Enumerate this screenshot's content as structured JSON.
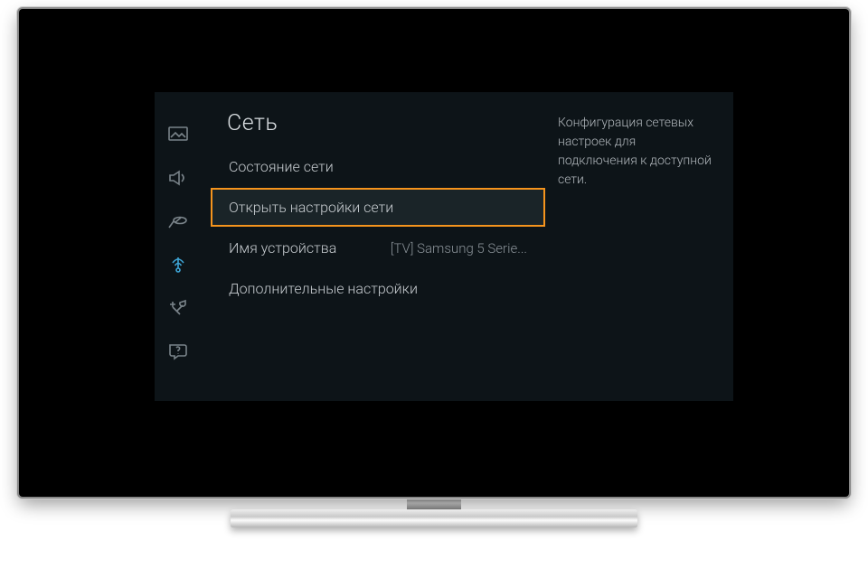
{
  "panel": {
    "title": "Сеть",
    "info_text": "Конфигурация сетевых настроек для подключения к доступной сети."
  },
  "menu": {
    "items": [
      {
        "label": "Состояние сети",
        "value": "",
        "highlighted": false
      },
      {
        "label": "Открыть настройки сети",
        "value": "",
        "highlighted": true
      },
      {
        "label": "Имя устройства",
        "value": "[TV] Samsung 5 Serie...",
        "highlighted": false
      },
      {
        "label": "Дополнительные настройки",
        "value": "",
        "highlighted": false
      }
    ]
  },
  "sidebar": {
    "icons": [
      {
        "name": "picture-icon",
        "active": false
      },
      {
        "name": "sound-icon",
        "active": false
      },
      {
        "name": "broadcast-icon",
        "active": false
      },
      {
        "name": "network-icon",
        "active": true
      },
      {
        "name": "system-icon",
        "active": false
      },
      {
        "name": "support-icon",
        "active": false
      }
    ]
  }
}
